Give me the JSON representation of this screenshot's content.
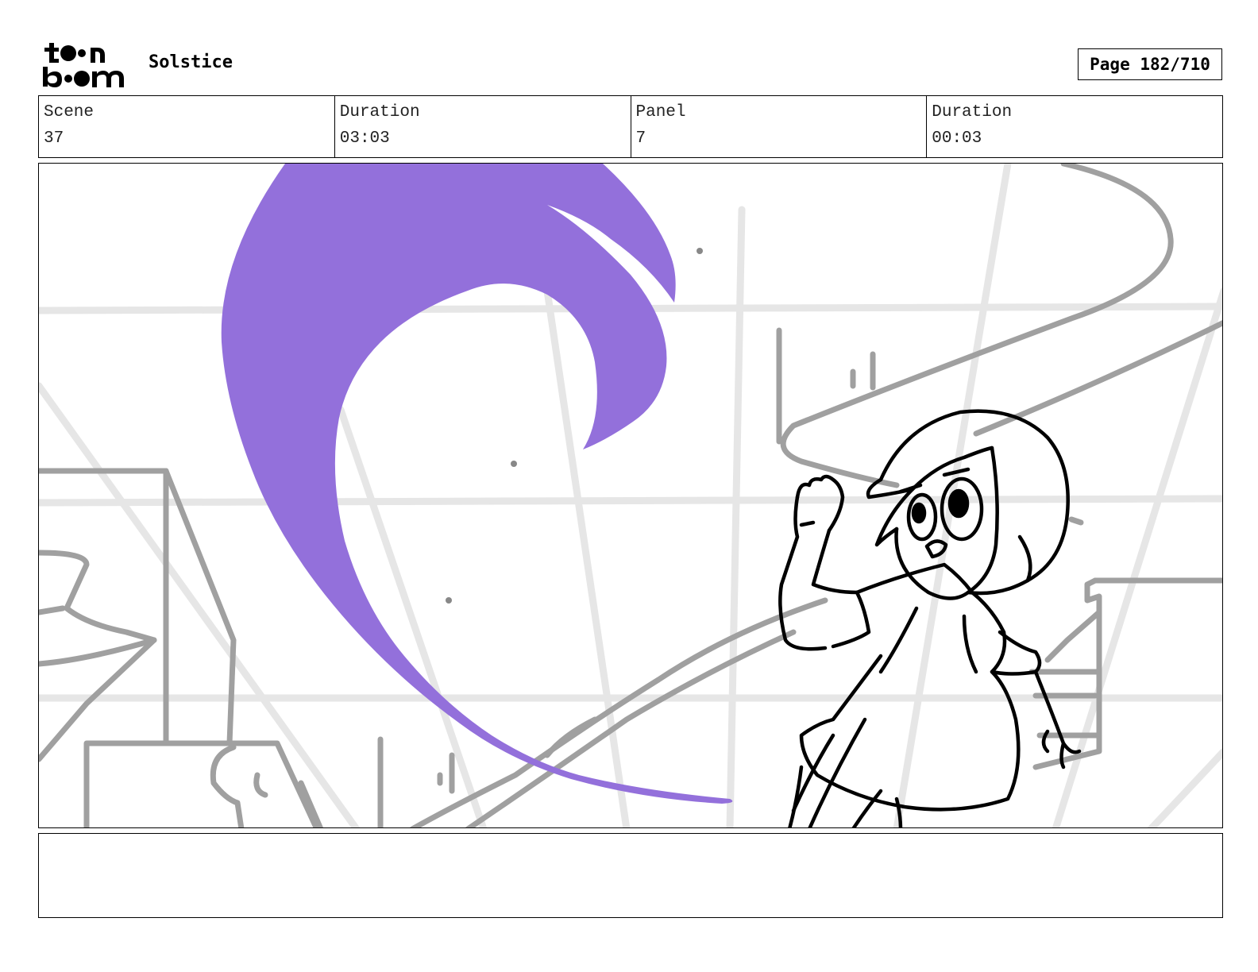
{
  "header": {
    "logo_text": "toon boom",
    "project_title": "Solstice",
    "page_indicator": "Page 182/710"
  },
  "info": {
    "scene_label": "Scene",
    "scene_value": "37",
    "scene_duration_label": "Duration",
    "scene_duration_value": "03:03",
    "panel_label": "Panel",
    "panel_value": "7",
    "panel_duration_label": "Duration",
    "panel_duration_value": "00:03"
  },
  "colors": {
    "swoosh": "#9370DB",
    "guide_lines": "#E6E6E6",
    "background_sketch": "#A0A0A0",
    "character_line": "#000000"
  },
  "notes": ""
}
